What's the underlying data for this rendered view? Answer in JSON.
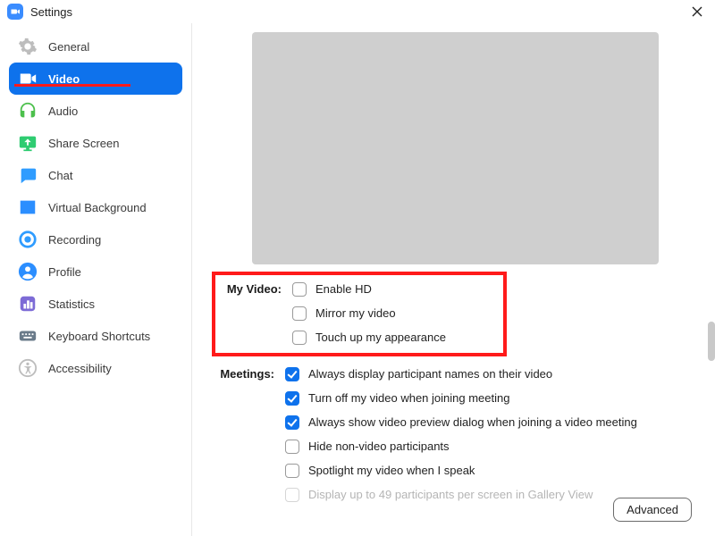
{
  "window": {
    "title": "Settings"
  },
  "sidebar": {
    "items": [
      {
        "label": "General"
      },
      {
        "label": "Video"
      },
      {
        "label": "Audio"
      },
      {
        "label": "Share Screen"
      },
      {
        "label": "Chat"
      },
      {
        "label": "Virtual Background"
      },
      {
        "label": "Recording"
      },
      {
        "label": "Profile"
      },
      {
        "label": "Statistics"
      },
      {
        "label": "Keyboard Shortcuts"
      },
      {
        "label": "Accessibility"
      }
    ],
    "active_index": 1
  },
  "video": {
    "groups": {
      "my_video": {
        "title": "My Video:",
        "options": [
          {
            "label": "Enable HD",
            "checked": false
          },
          {
            "label": "Mirror my video",
            "checked": false
          },
          {
            "label": "Touch up my appearance",
            "checked": false
          }
        ]
      },
      "meetings": {
        "title": "Meetings:",
        "options": [
          {
            "label": "Always display participant names on their video",
            "checked": true
          },
          {
            "label": "Turn off my video when joining meeting",
            "checked": true
          },
          {
            "label": "Always show video preview dialog when joining a video meeting",
            "checked": true
          },
          {
            "label": "Hide non-video participants",
            "checked": false
          },
          {
            "label": "Spotlight my video when I speak",
            "checked": false
          },
          {
            "label": "Display up to 49 participants per screen in Gallery View",
            "checked": false,
            "disabled": true
          }
        ]
      }
    },
    "advanced_label": "Advanced"
  }
}
